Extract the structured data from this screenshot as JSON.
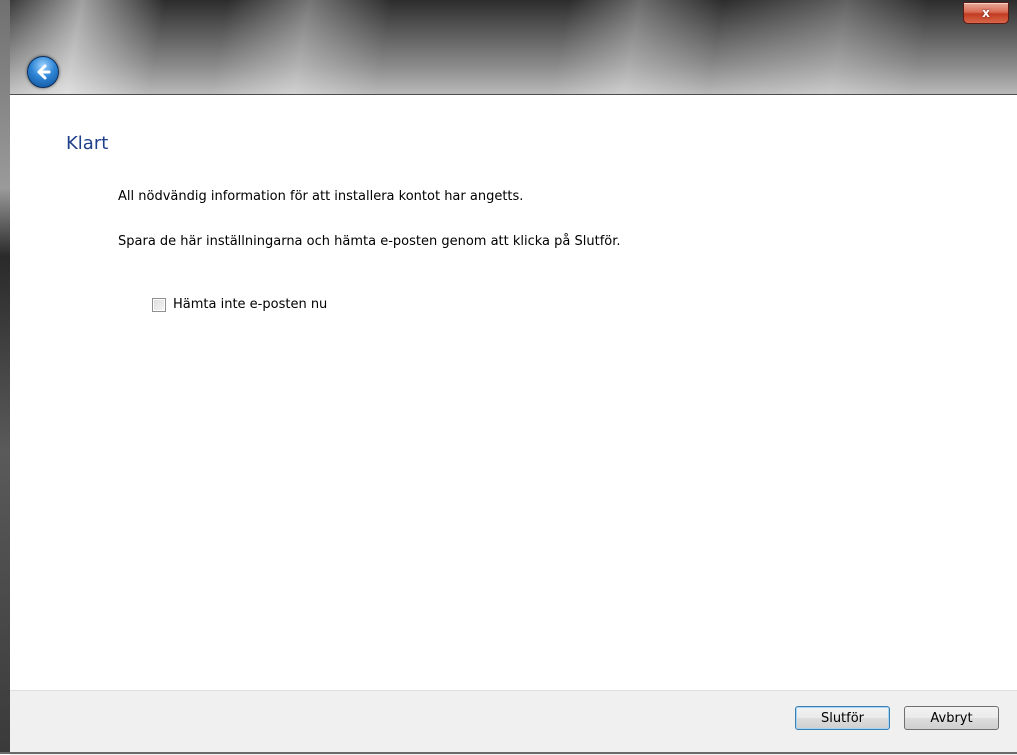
{
  "window": {
    "close_label": "x"
  },
  "wizard": {
    "title": "Klart",
    "info_line_1": "All nödvändig information för att installera kontot har angetts.",
    "info_line_2": "Spara de här inställningarna och hämta e-posten genom att klicka på Slutför.",
    "checkbox": {
      "label": "Hämta inte e-posten nu",
      "checked": false
    }
  },
  "footer": {
    "finish_label": "Slutför",
    "cancel_label": "Avbryt"
  },
  "icons": {
    "back": "back-arrow-icon",
    "close": "close-icon"
  }
}
